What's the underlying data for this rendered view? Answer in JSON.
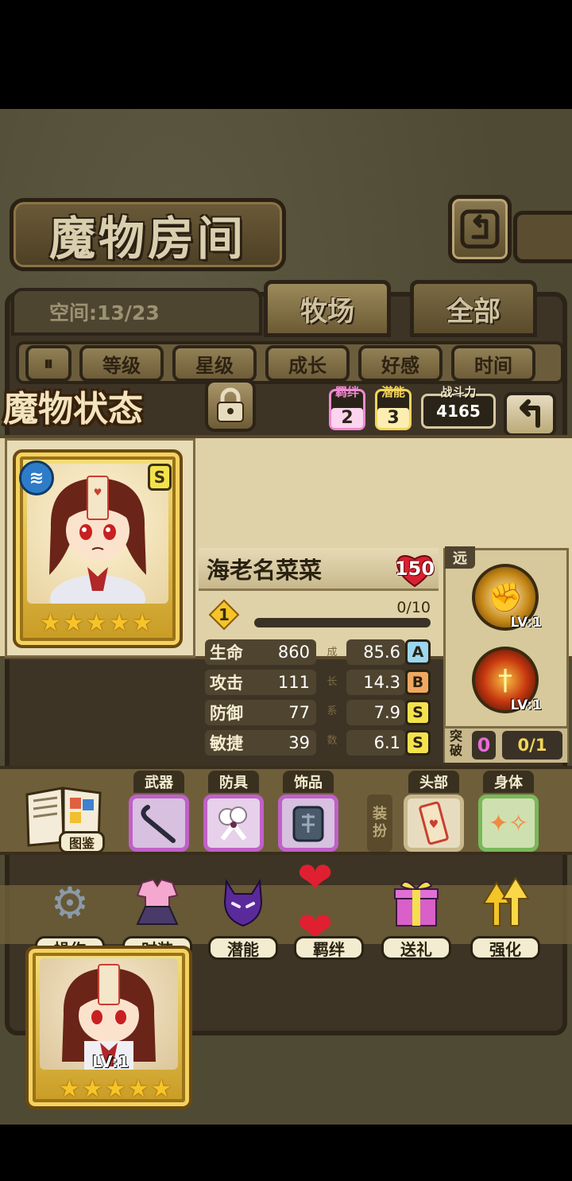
{
  "header": {
    "title": "魔物房间",
    "back_icon": "return-icon"
  },
  "space": {
    "label": "空间:13/23"
  },
  "tabs": [
    {
      "label": "牧场",
      "active": true
    },
    {
      "label": "全部",
      "active": false
    }
  ],
  "sort": {
    "toggle_icon": "pause-sort-icon",
    "buttons": [
      "等级",
      "星级",
      "成长",
      "好感",
      "时间"
    ]
  },
  "status": {
    "title": "魔物状态",
    "lock_icon": "lock-icon",
    "bond": {
      "label": "羁绊",
      "value": "2"
    },
    "potential": {
      "label": "潜能",
      "value": "3"
    },
    "power": {
      "label": "战斗力",
      "value": "4165"
    }
  },
  "monster": {
    "name": "海老名菜菜",
    "affection": "150",
    "rank": "S",
    "element_icon": "water-element-icon",
    "stars": 5,
    "level": "1",
    "exp": "0/10",
    "exp_fraction": 0,
    "stats": [
      {
        "label": "生命",
        "value": "860",
        "growth": "85.6",
        "grade": "A",
        "color": "#9ad8f0"
      },
      {
        "label": "攻击",
        "value": "111",
        "growth": "14.3",
        "grade": "B",
        "color": "#f0a860"
      },
      {
        "label": "防御",
        "value": "77",
        "growth": "7.9",
        "grade": "S",
        "color": "#f4e24c"
      },
      {
        "label": "敏捷",
        "value": "39",
        "growth": "6.1",
        "grade": "S",
        "color": "#f4e24c"
      }
    ],
    "growth_label": [
      "成",
      "长",
      "系",
      "数"
    ]
  },
  "skills": {
    "range": "远",
    "items": [
      {
        "icon": "fist-skill-icon",
        "level": "LV:1"
      },
      {
        "icon": "flame-sword-skill-icon",
        "level": "LV:1"
      }
    ],
    "breakthrough": {
      "label": "突破",
      "count": "0",
      "progress": "0/1"
    }
  },
  "equipment": {
    "book_label": "图鉴",
    "slots": [
      {
        "label": "武器",
        "icon": "crowbar-icon"
      },
      {
        "label": "防具",
        "icon": "armor-ribbon-icon"
      },
      {
        "label": "饰品",
        "icon": "stone-tablet-icon"
      }
    ],
    "dress_label": [
      "装",
      "扮"
    ],
    "dress_slots": [
      {
        "label": "头部",
        "icon": "talisman-icon"
      },
      {
        "label": "身体",
        "icon": "stars-body-icon"
      }
    ]
  },
  "actions": [
    {
      "label": "操作",
      "icon": "gear-icon"
    },
    {
      "label": "时装",
      "icon": "outfit-icon"
    },
    {
      "label": "潜能",
      "icon": "demon-icon"
    },
    {
      "label": "羁绊",
      "icon": "hearts-icon"
    },
    {
      "label": "送礼",
      "icon": "gift-icon"
    },
    {
      "label": "强化",
      "icon": "upgrade-arrows-icon"
    }
  ],
  "grid_card": {
    "level": "LV:1",
    "stars": 5
  },
  "colors": {
    "bond": "#f08ad0",
    "potential": "#f4d45c",
    "weapon_frame": "#c060c8",
    "armor_frame": "#c060c8",
    "accessory_frame": "#c060c8",
    "head_frame": "#c8b88c",
    "body_frame": "#7ab85a"
  }
}
